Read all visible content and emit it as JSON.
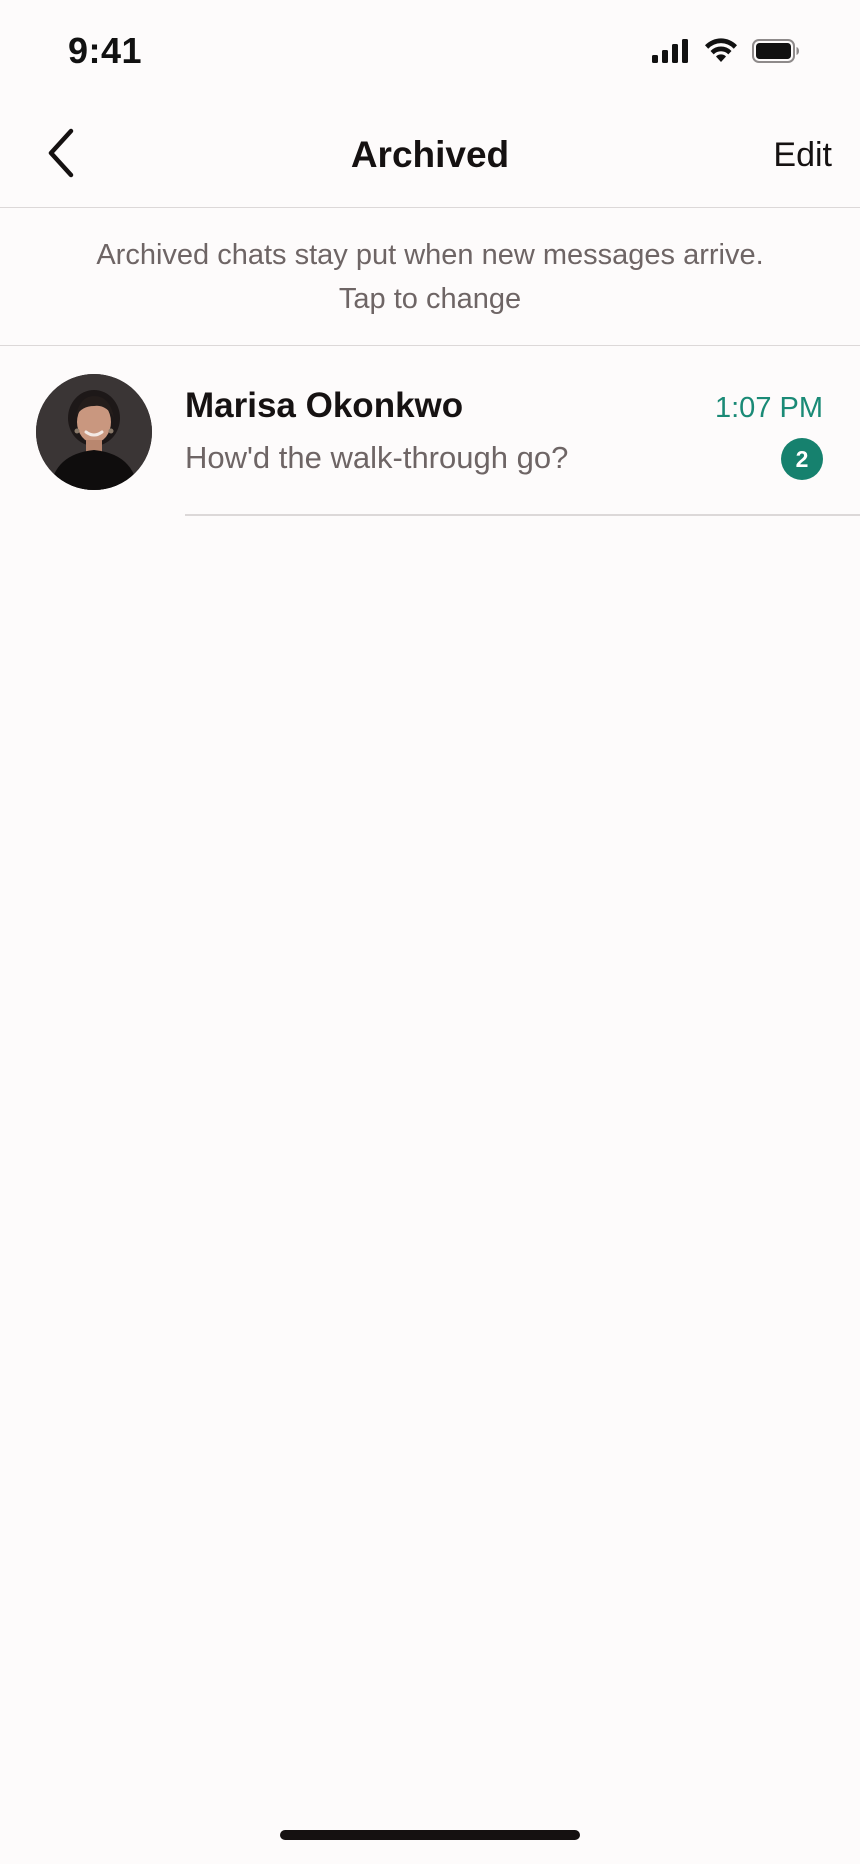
{
  "status_bar": {
    "time": "9:41",
    "icons": [
      "cellular-signal-icon",
      "wifi-icon",
      "battery-icon"
    ]
  },
  "nav": {
    "back_icon": "chevron-left-icon",
    "title": "Archived",
    "edit_label": "Edit"
  },
  "banner": {
    "text": "Archived chats stay put when new messages arrive. Tap to change"
  },
  "chats": [
    {
      "name": "Marisa Okonkwo",
      "preview": "How'd the walk-through go?",
      "time": "1:07 PM",
      "unread_count": "2"
    }
  ],
  "colors": {
    "accent": "#16816e",
    "time_accent": "#1a8a76",
    "background": "#fdfbfb",
    "secondary_text": "#6e6565",
    "divider": "#dcd8d8"
  }
}
